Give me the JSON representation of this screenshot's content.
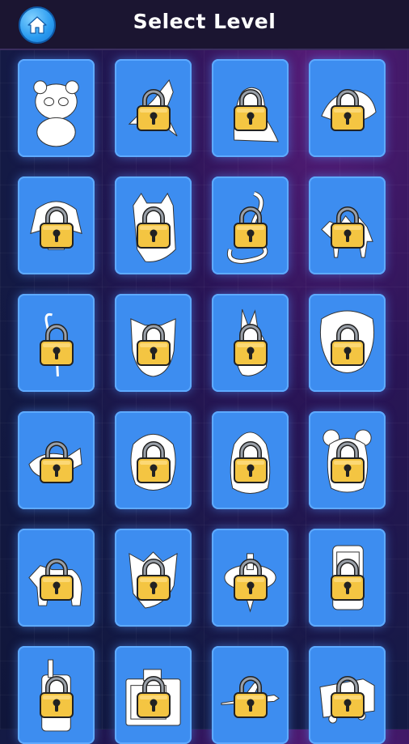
{
  "header": {
    "title": "Select Level",
    "home_icon": "home-icon"
  },
  "colors": {
    "card": "#3d8df0",
    "lock_body": "#f4c542",
    "home_button": "#2a9bf0"
  },
  "levels": [
    {
      "subject": "panda",
      "locked": false
    },
    {
      "subject": "bird",
      "locked": true
    },
    {
      "subject": "seal",
      "locked": true
    },
    {
      "subject": "hedgehog",
      "locked": true
    },
    {
      "subject": "dog",
      "locked": true
    },
    {
      "subject": "cat",
      "locked": true
    },
    {
      "subject": "snake",
      "locked": true
    },
    {
      "subject": "camel",
      "locked": true
    },
    {
      "subject": "flamingo",
      "locked": true
    },
    {
      "subject": "owl",
      "locked": true
    },
    {
      "subject": "rabbit",
      "locked": true
    },
    {
      "subject": "tiger",
      "locked": true
    },
    {
      "subject": "whale",
      "locked": true
    },
    {
      "subject": "turtle",
      "locked": true
    },
    {
      "subject": "penguin",
      "locked": true
    },
    {
      "subject": "koala",
      "locked": true
    },
    {
      "subject": "polar-bear",
      "locked": true
    },
    {
      "subject": "fox",
      "locked": true
    },
    {
      "subject": "spinning-top",
      "locked": true
    },
    {
      "subject": "smartphone",
      "locked": true
    },
    {
      "subject": "walkie-talkie",
      "locked": true
    },
    {
      "subject": "microwave",
      "locked": true
    },
    {
      "subject": "airplane",
      "locked": true
    },
    {
      "subject": "train",
      "locked": true
    }
  ]
}
